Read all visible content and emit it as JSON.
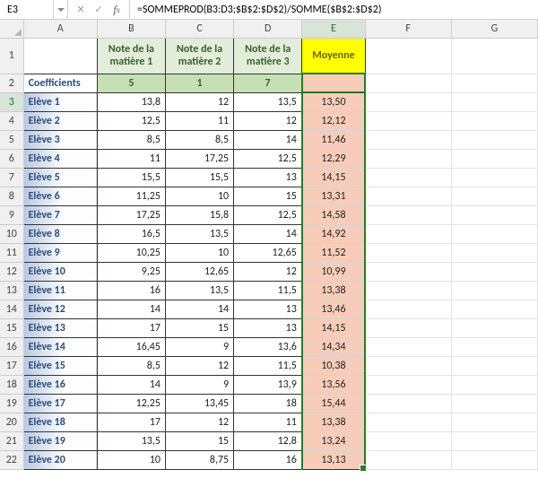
{
  "formula_bar": {
    "name_box": "E3",
    "formula": "=SOMMEPROD(B3:D3;$B$2:$D$2)/SOMME($B$2:$D$2)"
  },
  "columns": [
    "A",
    "B",
    "C",
    "D",
    "E",
    "F",
    "G"
  ],
  "active_column": "E",
  "active_row": 3,
  "headers": {
    "B": "Note de la matière 1",
    "C": "Note de la matière 2",
    "D": "Note de la matière 3",
    "E": "Moyenne"
  },
  "coefficients_label": "Coefficients",
  "coefficients": {
    "B": "5",
    "C": "1",
    "D": "7"
  },
  "rows": [
    {
      "n": 3,
      "label": "Elève 1",
      "B": "13,8",
      "C": "12",
      "D": "13,5",
      "E": "13,50"
    },
    {
      "n": 4,
      "label": "Elève 2",
      "B": "12,5",
      "C": "11",
      "D": "12",
      "E": "12,12"
    },
    {
      "n": 5,
      "label": "Elève 3",
      "B": "8,5",
      "C": "8,5",
      "D": "14",
      "E": "11,46"
    },
    {
      "n": 6,
      "label": "Elève 4",
      "B": "11",
      "C": "17,25",
      "D": "12,5",
      "E": "12,29"
    },
    {
      "n": 7,
      "label": "Elève 5",
      "B": "15,5",
      "C": "15,5",
      "D": "13",
      "E": "14,15"
    },
    {
      "n": 8,
      "label": "Elève 6",
      "B": "11,25",
      "C": "10",
      "D": "15",
      "E": "13,31"
    },
    {
      "n": 9,
      "label": "Elève 7",
      "B": "17,25",
      "C": "15,8",
      "D": "12,5",
      "E": "14,58"
    },
    {
      "n": 10,
      "label": "Elève 8",
      "B": "16,5",
      "C": "13,5",
      "D": "14",
      "E": "14,92"
    },
    {
      "n": 11,
      "label": "Elève 9",
      "B": "10,25",
      "C": "10",
      "D": "12,65",
      "E": "11,52"
    },
    {
      "n": 12,
      "label": "Elève 10",
      "B": "9,25",
      "C": "12,65",
      "D": "12",
      "E": "10,99"
    },
    {
      "n": 13,
      "label": "Elève 11",
      "B": "16",
      "C": "13,5",
      "D": "11,5",
      "E": "13,38"
    },
    {
      "n": 14,
      "label": "Elève 12",
      "B": "14",
      "C": "14",
      "D": "13",
      "E": "13,46"
    },
    {
      "n": 15,
      "label": "Elève 13",
      "B": "17",
      "C": "15",
      "D": "13",
      "E": "14,15"
    },
    {
      "n": 16,
      "label": "Elève 14",
      "B": "16,45",
      "C": "9",
      "D": "13,6",
      "E": "14,34"
    },
    {
      "n": 17,
      "label": "Elève 15",
      "B": "8,5",
      "C": "12",
      "D": "11,5",
      "E": "10,38"
    },
    {
      "n": 18,
      "label": "Elève 16",
      "B": "14",
      "C": "9",
      "D": "13,9",
      "E": "13,56"
    },
    {
      "n": 19,
      "label": "Elève 17",
      "B": "12,25",
      "C": "13,45",
      "D": "18",
      "E": "15,44"
    },
    {
      "n": 20,
      "label": "Elève 18",
      "B": "17",
      "C": "12",
      "D": "11",
      "E": "13,38"
    },
    {
      "n": 21,
      "label": "Elève 19",
      "B": "13,5",
      "C": "15",
      "D": "12,8",
      "E": "13,24"
    },
    {
      "n": 22,
      "label": "Elève 20",
      "B": "10",
      "C": "8,75",
      "D": "16",
      "E": "13,13"
    }
  ]
}
